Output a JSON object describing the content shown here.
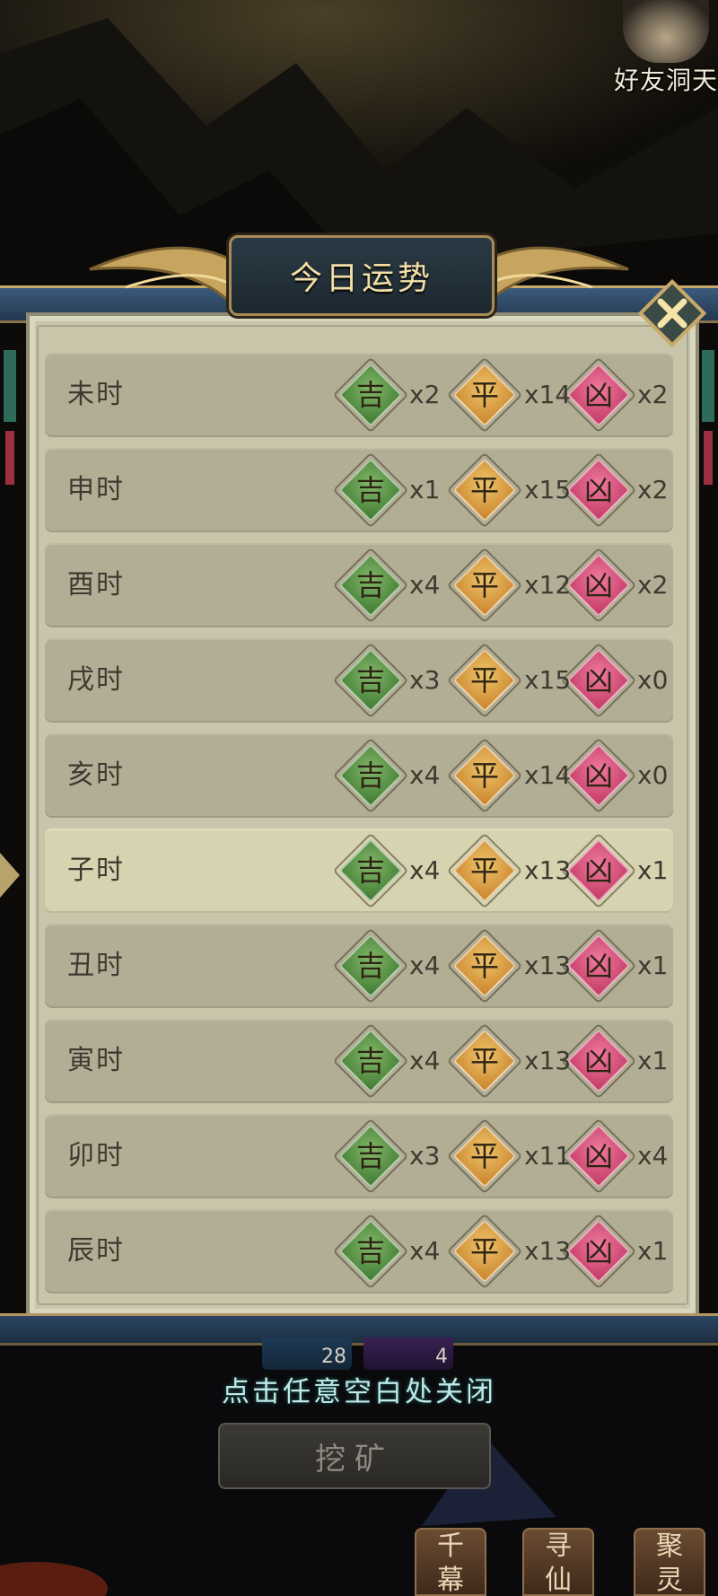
{
  "header": {
    "friend_cave_label": "好友洞天"
  },
  "dialog": {
    "title": "今日运势",
    "close_icon": "close-x-icon",
    "symbols": {
      "good": "吉",
      "neutral": "平",
      "bad": "凶"
    },
    "colors": {
      "good": "#4f8a3e",
      "neutral": "#d8973a",
      "bad": "#d24a74"
    },
    "rows": [
      {
        "name": "未时",
        "good": "x2",
        "neutral": "x14",
        "bad": "x2"
      },
      {
        "name": "申时",
        "good": "x1",
        "neutral": "x15",
        "bad": "x2"
      },
      {
        "name": "酉时",
        "good": "x4",
        "neutral": "x12",
        "bad": "x2"
      },
      {
        "name": "戌时",
        "good": "x3",
        "neutral": "x15",
        "bad": "x0"
      },
      {
        "name": "亥时",
        "good": "x4",
        "neutral": "x14",
        "bad": "x0"
      },
      {
        "name": "子时",
        "good": "x4",
        "neutral": "x13",
        "bad": "x1",
        "highlight": true
      },
      {
        "name": "丑时",
        "good": "x4",
        "neutral": "x13",
        "bad": "x1"
      },
      {
        "name": "寅时",
        "good": "x4",
        "neutral": "x13",
        "bad": "x1"
      },
      {
        "name": "卯时",
        "good": "x3",
        "neutral": "x11",
        "bad": "x4"
      },
      {
        "name": "辰时",
        "good": "x4",
        "neutral": "x13",
        "bad": "x1"
      }
    ]
  },
  "footer": {
    "slot_a_count": "28",
    "slot_b_count": "4",
    "close_hint": "点击任意空白处关闭",
    "mine_button": "挖矿",
    "tabs": [
      {
        "line1": "千",
        "line2": "幕"
      },
      {
        "line1": "寻",
        "line2": "仙"
      },
      {
        "line1": "聚",
        "line2": "灵"
      }
    ]
  }
}
